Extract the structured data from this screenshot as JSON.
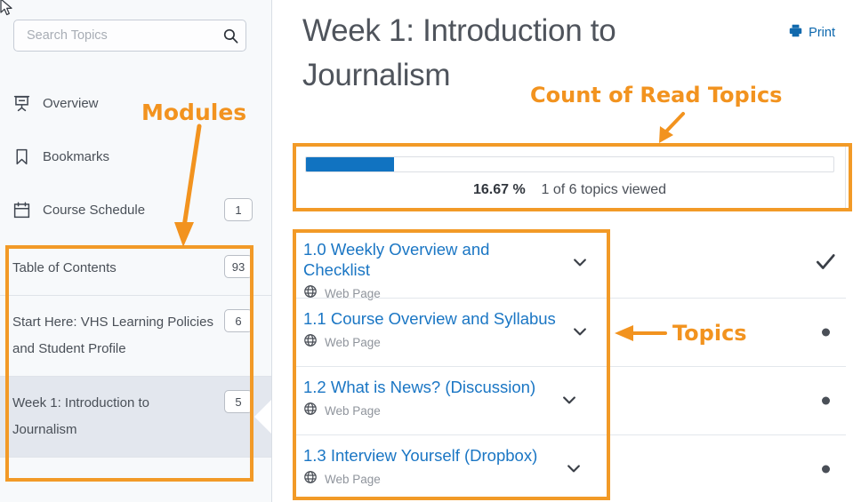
{
  "sidebar": {
    "search": {
      "placeholder": "Search Topics",
      "value": "",
      "icon": "search-icon"
    },
    "nav": [
      {
        "label": "Overview",
        "icon": "presentation-screen-icon",
        "badge": ""
      },
      {
        "label": "Bookmarks",
        "icon": "bookmark-icon",
        "badge": ""
      },
      {
        "label": "Course Schedule",
        "icon": "calendar-icon",
        "badge": "1"
      }
    ],
    "modules": [
      {
        "title": "Table of Contents",
        "badge": "93",
        "selected": false
      },
      {
        "title": "Start Here: VHS Learning Policies and Student Profile",
        "badge": "6",
        "selected": false
      },
      {
        "title": "Week 1: Introduction to Journalism",
        "badge": "5",
        "selected": true
      }
    ]
  },
  "main": {
    "title": "Week 1: Introduction to Journalism",
    "print_label": "Print",
    "print_icon": "printer-icon",
    "progress": {
      "percent_value": "16.67",
      "percent_symbol": "%",
      "summary": "1 of 6 topics viewed",
      "fill_percent": 16.67,
      "fill_color": "#1173c1"
    },
    "topics": [
      {
        "name": "1.0 Weekly Overview and Checklist",
        "type": "Web Page",
        "type_icon": "globe-icon",
        "expand_icon": "chevron-down-icon",
        "status": "check"
      },
      {
        "name": "1.1 Course Overview and Syllabus",
        "type": "Web Page",
        "type_icon": "globe-icon",
        "expand_icon": "chevron-down-icon",
        "status": "dot"
      },
      {
        "name": "1.2 What is News? (Discussion)",
        "type": "Web Page",
        "type_icon": "globe-icon",
        "expand_icon": "chevron-down-icon",
        "status": "dot"
      },
      {
        "name": "1.3 Interview Yourself (Dropbox)",
        "type": "Web Page",
        "type_icon": "globe-icon",
        "expand_icon": "chevron-down-icon",
        "status": "dot"
      }
    ]
  },
  "annotations": {
    "color": "#f2931f",
    "labels": [
      {
        "text": "Modules",
        "id": "modules"
      },
      {
        "text": "Count of Read Topics",
        "id": "count-of-read-topics"
      },
      {
        "text": "Topics",
        "id": "topics"
      }
    ]
  }
}
